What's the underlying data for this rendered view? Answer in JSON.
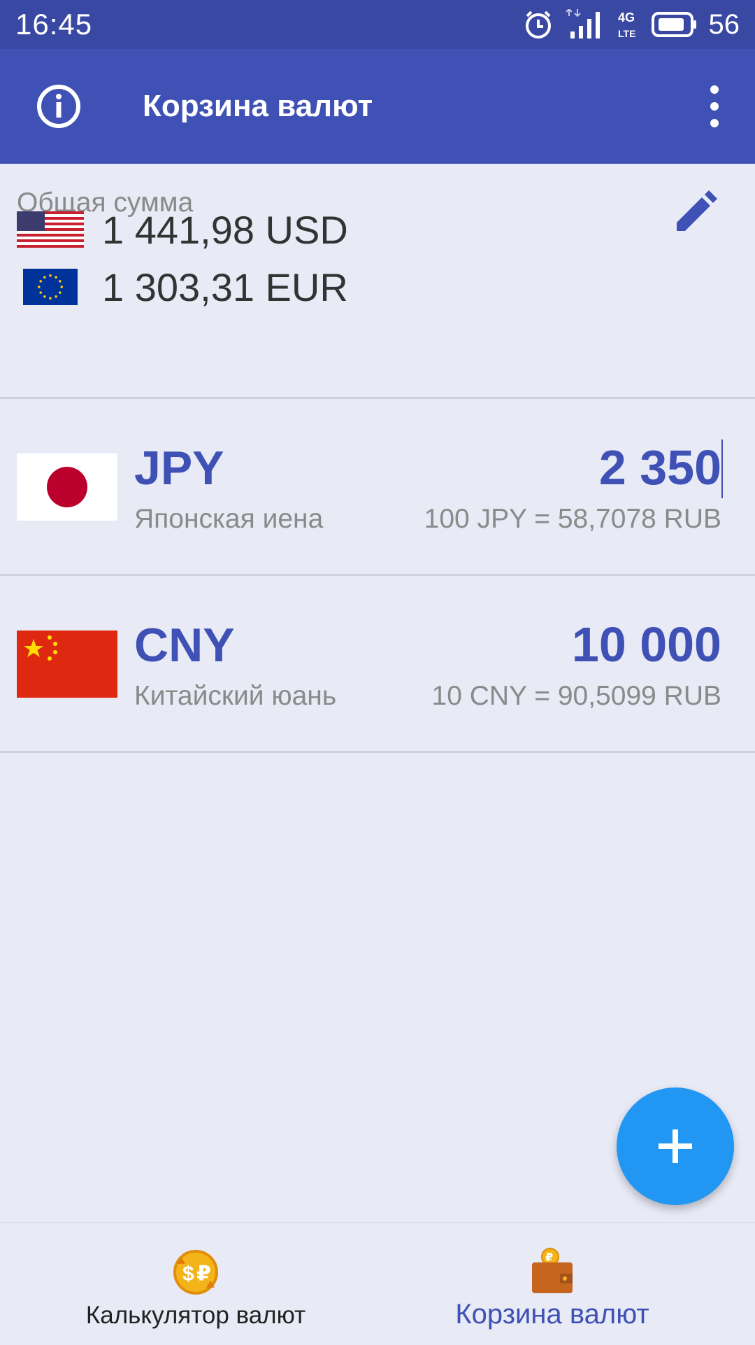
{
  "status_bar": {
    "time": "16:45",
    "network_label": "4G LTE",
    "battery_percent": "56",
    "icons": [
      "alarm-icon",
      "data-arrows-icon",
      "signal-icon",
      "network-type-icon",
      "battery-icon"
    ]
  },
  "app_bar": {
    "title": "Корзина валют",
    "info_icon": "info-icon",
    "more_icon": "more-vert-icon"
  },
  "total": {
    "label": "Общая сумма",
    "edit_icon": "pencil-icon",
    "rows": [
      {
        "flag": "us-flag",
        "amount": "1 441,98 USD"
      },
      {
        "flag": "eu-flag",
        "amount": "1 303,31 EUR"
      }
    ]
  },
  "currencies": [
    {
      "flag": "jp-flag",
      "code": "JPY",
      "name": "Японская иена",
      "value": "2 350",
      "rate": "100 JPY = 58,7078 RUB"
    },
    {
      "flag": "cn-flag",
      "code": "CNY",
      "name": "Китайский юань",
      "value": "10 000",
      "rate": "10 CNY = 90,5099 RUB"
    }
  ],
  "fab": {
    "icon": "plus-icon"
  },
  "bottom_nav": {
    "items": [
      {
        "label": "Калькулятор валют",
        "icon": "currency-exchange-icon",
        "active": false
      },
      {
        "label": "Корзина валют",
        "icon": "wallet-icon",
        "active": true
      }
    ]
  },
  "colors": {
    "status_bar": "#3949a3",
    "app_bar": "#3f51b5",
    "background": "#e8eaf6",
    "accent": "#3f51b5",
    "fab": "#2196f3"
  }
}
